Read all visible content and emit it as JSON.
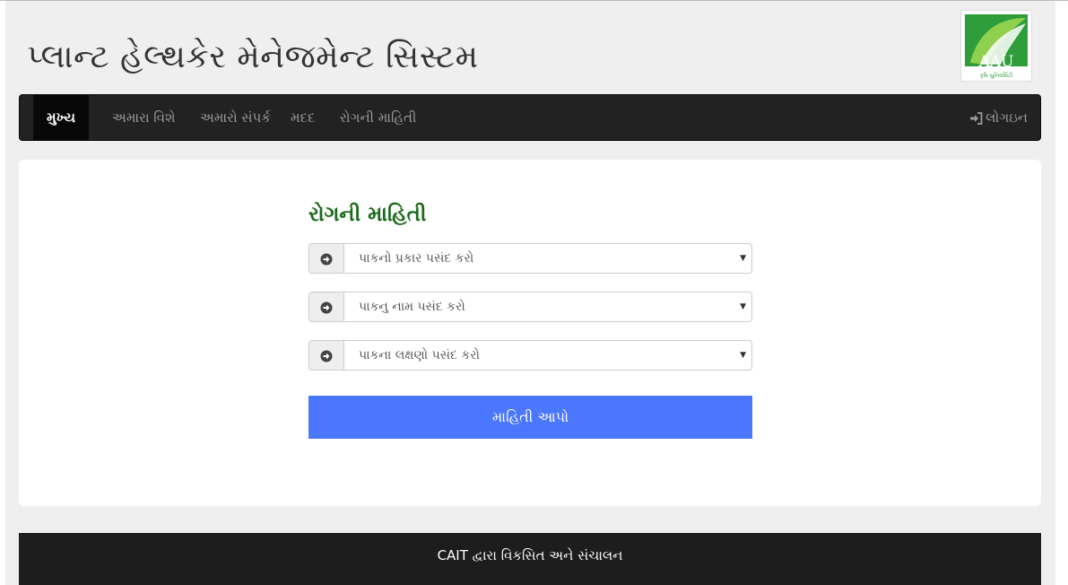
{
  "header": {
    "title": "પ્લાન્ટ હેલ્થકેર મેનેજમેન્ટ સિસ્ટમ",
    "logo_text": "AAU",
    "logo_subtext": "કૃષિ યુનિવર્સિટી"
  },
  "nav": {
    "items": [
      {
        "label": "મુખ્ય",
        "active": true
      },
      {
        "label": "અમારા વિશે",
        "active": false
      },
      {
        "label": "અમારો સંપર્ક",
        "active": false
      },
      {
        "label": "મદદ",
        "active": false
      },
      {
        "label": "રોગની માહિતી",
        "active": false
      }
    ],
    "login_label": "લોગઇન"
  },
  "form": {
    "title": "રોગની માહિતી",
    "selects": [
      {
        "value": "પાકનો પ્રકાર પસંદ કરો"
      },
      {
        "value": "પાકનુ નામ પસંદ કરો"
      },
      {
        "value": "પાકના લક્ષણો પસંદ કરો"
      }
    ],
    "submit_label": "માહિતી આપો"
  },
  "footer": {
    "text": "CAIT દ્વારા વિકસિત અને સંચાલન"
  },
  "colors": {
    "accent": "#4a77fd",
    "title_green": "#1a6b1a",
    "navbar": "#222222"
  }
}
